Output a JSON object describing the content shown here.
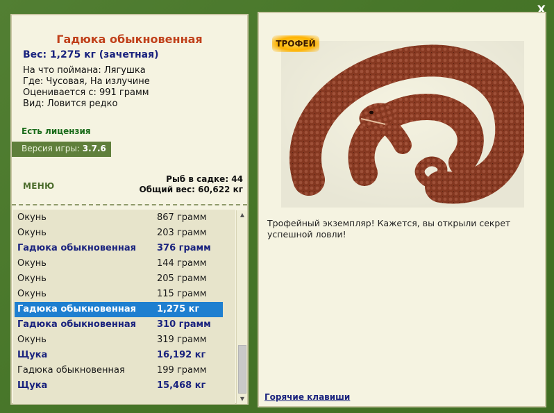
{
  "window": {
    "close_label": "X"
  },
  "catch": {
    "title": "Гадюка обыкновенная",
    "weight_line": "Вес: 1,275 кг (зачетная)",
    "bait_line": "На что поймана: Лягушка",
    "place_line": "Где: Чусовая, На излучине",
    "scored_line": "Оценивается с: 991 грамм",
    "kind_line": "Вид: Ловится редко"
  },
  "license": "Есть лицензия",
  "version": {
    "label": "Версия игры: ",
    "value": "3.7.6"
  },
  "menu_label": "МЕНЮ",
  "stats": {
    "fish_count": "Рыб в садке: 44",
    "total_weight": "Общий вес: 60,622 кг"
  },
  "fish_list": [
    {
      "name": "Окунь",
      "weight": "867 грамм",
      "trophy": false,
      "selected": false
    },
    {
      "name": "Окунь",
      "weight": "203 грамм",
      "trophy": false,
      "selected": false
    },
    {
      "name": "Гадюка обыкновенная",
      "weight": "376 грамм",
      "trophy": true,
      "selected": false
    },
    {
      "name": "Окунь",
      "weight": "144 грамм",
      "trophy": false,
      "selected": false
    },
    {
      "name": "Окунь",
      "weight": "205 грамм",
      "trophy": false,
      "selected": false
    },
    {
      "name": "Окунь",
      "weight": "115 грамм",
      "trophy": false,
      "selected": false
    },
    {
      "name": "Гадюка обыкновенная",
      "weight": "1,275 кг",
      "trophy": true,
      "selected": true
    },
    {
      "name": "Гадюка обыкновенная",
      "weight": "310 грамм",
      "trophy": true,
      "selected": false
    },
    {
      "name": "Окунь",
      "weight": "319 грамм",
      "trophy": false,
      "selected": false
    },
    {
      "name": "Щука",
      "weight": "16,192 кг",
      "trophy": true,
      "selected": false
    },
    {
      "name": "Гадюка обыкновенная",
      "weight": "199 грамм",
      "trophy": false,
      "selected": false
    },
    {
      "name": "Щука",
      "weight": "15,468 кг",
      "trophy": true,
      "selected": false
    }
  ],
  "trophy_badge": "ТРОФЕЙ",
  "description": "Трофейный экземпляр! Кажется, вы открыли секрет успешной ловли!",
  "hotkeys_label": "Горячие клавиши",
  "colors": {
    "frame": "#4a7a2a",
    "panel": "#f5f3e1",
    "title": "#c0401a",
    "trophy_text": "#1a237e",
    "selection": "#1e7fd0",
    "license": "#1a6b1a"
  }
}
